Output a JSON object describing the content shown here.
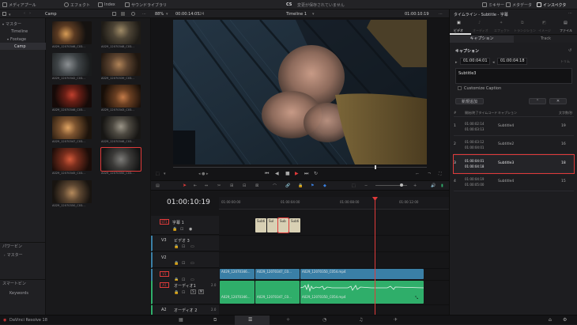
{
  "menubar": {
    "media_pool": "メディアプール",
    "effects": "エフェクト",
    "index": "Index",
    "sound_library": "サウンドライブラリ",
    "project_code": "CS",
    "save_status": "変更が保存されていません",
    "mixer": "ミキサー",
    "metadata": "メタデータ",
    "inspector": "インスペクタ"
  },
  "toolbar": {
    "bin_name": "Camp",
    "zoom": "88%",
    "source_timecode": "00:00:14:05",
    "fps": "24",
    "timeline_name": "Timeline 1",
    "record_timecode": "01:00:10:19"
  },
  "bins": {
    "master": "マスター",
    "items": [
      "Timeline",
      "Footage",
      "Camp"
    ],
    "power_bins": "パワービン",
    "power_master": "マスター",
    "smart_bins": "スマートビン",
    "keywords": "Keywords"
  },
  "clips": [
    "A029_12070346_C03...",
    "A029_12070348_C03...",
    "A029_12070342_C03...",
    "A029_12070339_C03...",
    "A029_12070346_C03...",
    "A029_12070343_C03...",
    "A029_12070347_C03...",
    "A029_12070346_C03...",
    "A029_12070345_C03...",
    "A029_12070350_C03...",
    "A029_12070350_C03..."
  ],
  "timeline": {
    "timecode": "01:00:10:19",
    "ruler": [
      "01:00:00:00",
      "01:00:04:00",
      "01:00:08:00",
      "01:00:12:00"
    ],
    "tracks": {
      "st1_tag": "ST1",
      "st1_name": "字幕 1",
      "v3_tag": "V3",
      "v3_name": "ビデオ 3",
      "v2_tag": "V2",
      "v1_tag": "V1",
      "a1_tag": "A1",
      "a1_name": "オーディオ1",
      "a1_level": "2.0",
      "a2_tag": "A2",
      "a2_name": "オーディオ 2",
      "a2_level": "2.0",
      "a1_s": "S",
      "a1_m": "M"
    },
    "subtitle_clips": [
      "Subti",
      "Sul",
      "Sub",
      "Subti"
    ],
    "video_clips": [
      "A029_12070346...",
      "A029_12070347_C0...",
      "A029_12070350_C054.mp4"
    ],
    "audio_clips": [
      "A029_12070346...",
      "A029_12070347_C0...",
      "A029_12070350_C054.mp4"
    ]
  },
  "inspector": {
    "title": "タイムライン - Subtitle - 字幕",
    "tabs": [
      "ビデオ",
      "オーディオ",
      "エフェクト",
      "トランジション",
      "イメージ",
      "ファイル"
    ],
    "subtabs": [
      "キャプション",
      "Track"
    ],
    "section": "キャプション",
    "in_tc": "01:00:04:01",
    "out_tc": "01:00:04:18",
    "tc_label": "トリム",
    "caption_text": "Subtitle3",
    "customize_caption": "Customize Caption",
    "new_caption": "新規追加",
    "head_num": "#",
    "head_time": "開始/終了タイムコード",
    "head_caption": "キャプション",
    "head_chars": "文字数/秒",
    "rows": [
      {
        "n": "1",
        "in": "01:00:02:14",
        "out": "01:00:03:13",
        "text": "Subtitle4",
        "cps": "19"
      },
      {
        "n": "2",
        "in": "01:00:03:12",
        "out": "01:00:04:01",
        "text": "Subtitle2",
        "cps": "16"
      },
      {
        "n": "3",
        "in": "01:00:04:01",
        "out": "01:00:04:18",
        "text": "Subtitle3",
        "cps": "18"
      },
      {
        "n": "4",
        "in": "01:00:04:19",
        "out": "01:00:05:00",
        "text": "Subtitle4",
        "cps": "15"
      }
    ]
  },
  "statusbar": {
    "app_name": "DaVinci Resolve 18"
  },
  "colors": {
    "accent_red": "#e03a3a",
    "video_clip": "#3a7fa6",
    "audio_clip": "#2fae6a",
    "subtitle_clip": "#d8d0b4"
  }
}
